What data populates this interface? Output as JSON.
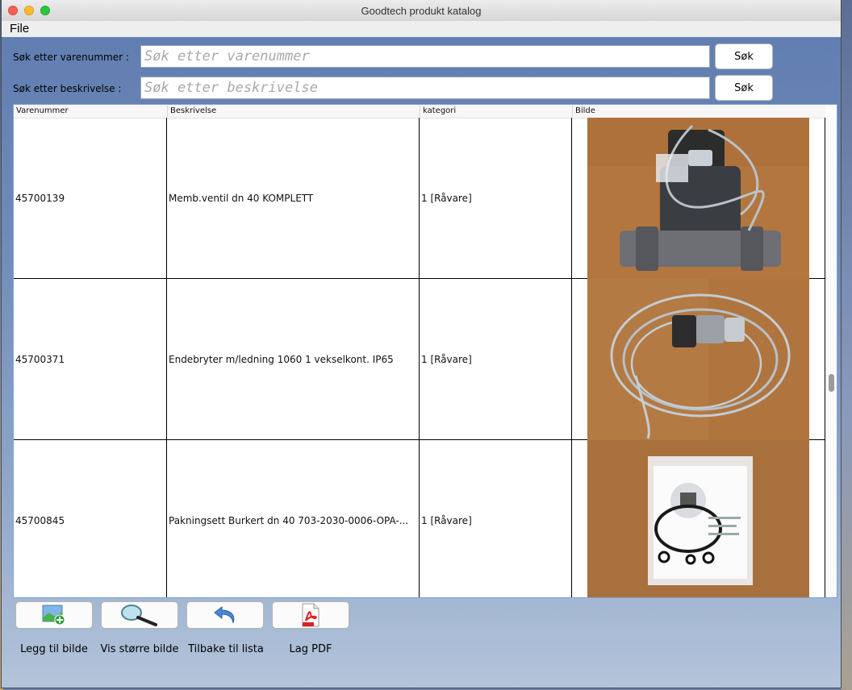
{
  "window": {
    "title": "Goodtech produkt katalog"
  },
  "menu": {
    "file": "File"
  },
  "search": {
    "varenummer_label": "Søk etter varenummer  :",
    "varenummer_placeholder": "Søk etter varenummer",
    "varenummer_button": "Søk",
    "beskrivelse_label": "Søk etter beskrivelse :",
    "beskrivelse_placeholder": "Søk etter beskrivelse",
    "beskrivelse_button": "Søk"
  },
  "table": {
    "columns": [
      "Varenummer",
      "Beskrivelse",
      "kategori",
      "Bilde"
    ],
    "rows": [
      {
        "varenummer": "45700139",
        "beskrivelse": "Memb.ventil dn 40 KOMPLETT",
        "kategori": "1 [Råvare]",
        "image_icon": "valve-photo"
      },
      {
        "varenummer": "45700371",
        "beskrivelse": "Endebryter m/ledning 1060 1 vekselkont. IP65",
        "kategori": "1 [Råvare]",
        "image_icon": "cable-switch-photo"
      },
      {
        "varenummer": "45700845",
        "beskrivelse": "Pakningsett Burkert dn 40 703-2030-0006-OPA-...",
        "kategori": "1 [Råvare]",
        "image_icon": "gasket-kit-photo"
      }
    ]
  },
  "toolbar": {
    "add_image": {
      "label": "Legg til bilde",
      "icon": "add-image-icon"
    },
    "show_larger": {
      "label": "Vis større bilde",
      "icon": "magnifier-icon"
    },
    "back": {
      "label": "Tilbake til lista",
      "icon": "undo-arrow-icon"
    },
    "pdf": {
      "label": "Lag PDF",
      "icon": "pdf-icon"
    }
  },
  "colors": {
    "window_bg_top": "#5f7cb0",
    "table_border": "#7ea1d6",
    "photo_bg": "#b0743f"
  }
}
